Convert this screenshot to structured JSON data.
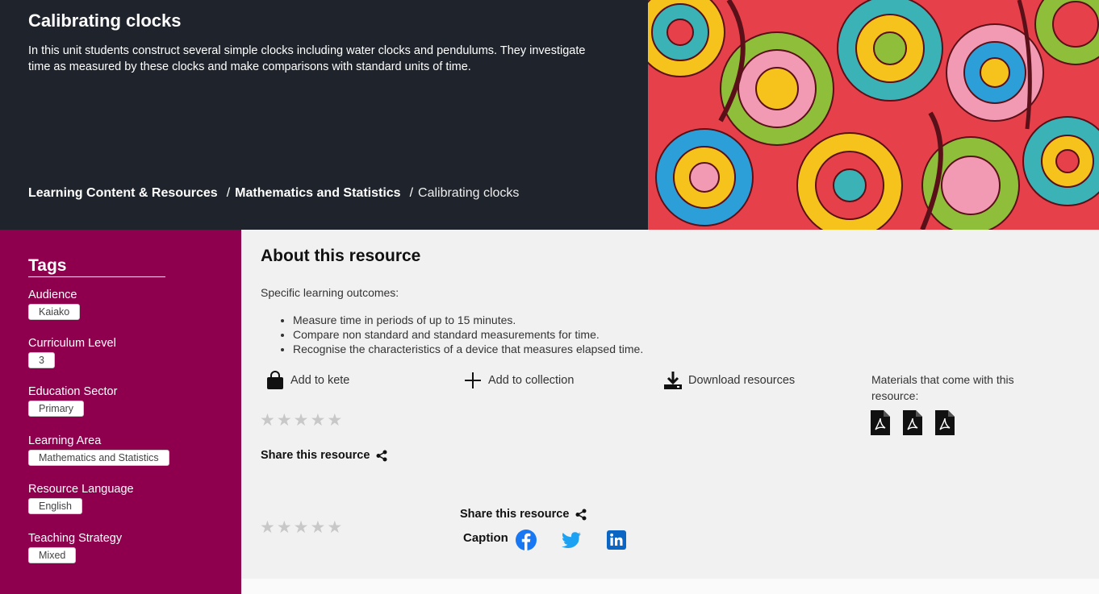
{
  "hero": {
    "title": "Calibrating clocks",
    "description": "In this unit students construct several simple clocks including water clocks and pendulums. They investigate time as measured by these clocks and make comparisons with standard units of time.",
    "breadcrumb": {
      "items": [
        "Learning Content & Resources",
        "Mathematics and Statistics"
      ],
      "separator": "/",
      "current": "Calibrating clocks"
    }
  },
  "tags": {
    "heading": "Tags",
    "groups": [
      {
        "label": "Audience",
        "value": "Kaiako"
      },
      {
        "label": "Curriculum Level",
        "value": "3"
      },
      {
        "label": "Education Sector",
        "value": "Primary"
      },
      {
        "label": "Learning Area",
        "value": "Mathematics and Statistics"
      },
      {
        "label": "Resource Language",
        "value": "English"
      },
      {
        "label": "Teaching Strategy",
        "value": "Mixed"
      }
    ]
  },
  "about": {
    "heading": "About this resource",
    "intro": "Specific learning outcomes:",
    "outcomes": [
      "Measure time in periods of up to 15 minutes.",
      "Compare non standard and standard measurements for time.",
      "Recognise the characteristics of a device that measures elapsed time."
    ]
  },
  "actions": {
    "kete": "Add to kete",
    "collection": "Add to collection",
    "download": "Download resources"
  },
  "materials": {
    "label": "Materials that come with this resource:",
    "files": [
      "pdf-icon",
      "pdf-icon",
      "pdf-icon"
    ]
  },
  "rating": {
    "stars": 5,
    "filled": 0
  },
  "share": {
    "label": "Share this resource",
    "caption": "Caption"
  },
  "social": [
    "facebook-icon",
    "twitter-icon",
    "linkedin-icon"
  ],
  "colors": {
    "hero_bg": "#1f232b",
    "sidebar_bg": "#8e004e",
    "main_bg": "#f1f1f1",
    "facebook": "#1877f2",
    "twitter": "#1da1f2",
    "linkedin": "#0a66c2"
  }
}
